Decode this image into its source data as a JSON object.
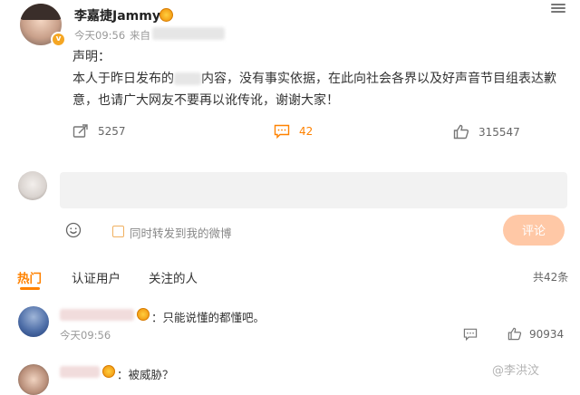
{
  "post": {
    "username": "李嘉捷Jammy",
    "time": "今天09:56",
    "from_label": "来自",
    "title_line": "声明：",
    "line1_prefix": "本人于昨日发布的",
    "line1_suffix": "内容，没有事实依据，在此向社会各界以及好声音节目组表达歉",
    "line2": "意，也请广大网友不要再以讹传讹，谢谢大家！",
    "reposts": "5257",
    "comments": "42",
    "likes": "315547"
  },
  "composer": {
    "placeholder": "",
    "also_repost_label": "同时转发到我的微博",
    "submit_label": "评论"
  },
  "tabs": [
    {
      "label": "热门",
      "active": true
    },
    {
      "label": "认证用户",
      "active": false
    },
    {
      "label": "关注的人",
      "active": false
    }
  ],
  "total_comments": "共42条",
  "comments_list": [
    {
      "text": "：只能说懂的都懂吧。",
      "time": "今天09:56",
      "likes": "90934"
    },
    {
      "text": "：被威胁？"
    }
  ],
  "watermark": "@李洪汶",
  "colors": {
    "accent": "#ff8200",
    "button_disabled": "#ffc8a6"
  },
  "icons": [
    "repost-icon",
    "comment-icon",
    "like-icon",
    "emoji-icon",
    "more-icon",
    "verified-badge-icon",
    "medal-icon"
  ]
}
